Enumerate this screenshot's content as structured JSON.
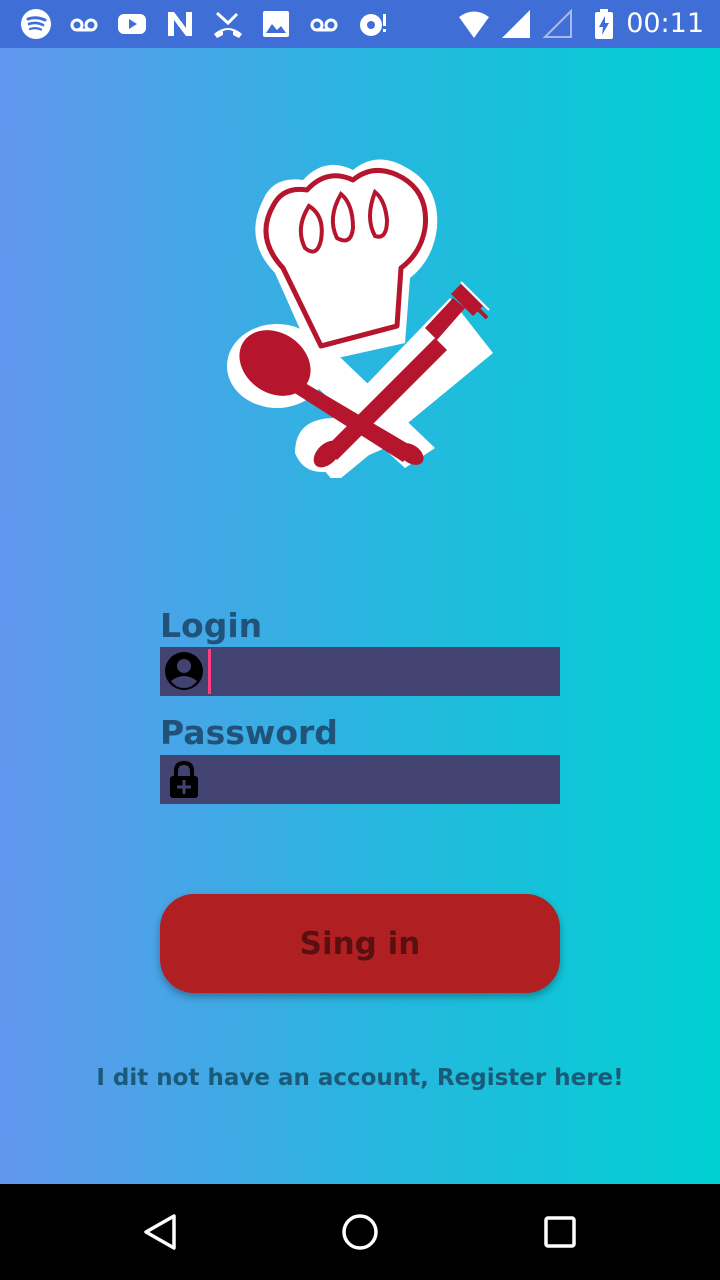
{
  "status_bar": {
    "time": "00:11",
    "icons": [
      "spotify-icon",
      "voicemail-icon",
      "youtube-icon",
      "n-app-icon",
      "missed-call-icon",
      "image-icon",
      "voicemail-icon",
      "sync-icon",
      "wifi-icon",
      "cell-signal-icon",
      "cell-signal-empty-icon",
      "battery-charging-icon"
    ]
  },
  "logo": {
    "icon": "chef-hat-spoon-fork-logo"
  },
  "form": {
    "login_label": "Login",
    "login_value": "",
    "login_icon": "account-circle-icon",
    "password_label": "Password",
    "password_value": "",
    "password_icon": "lock-plus-icon"
  },
  "signin_label": "Sing in",
  "register_text": "I dit not have an account, Register here!",
  "nav_bar": {
    "buttons": [
      "back-icon",
      "home-icon",
      "recents-icon"
    ]
  },
  "colors": {
    "status_bar": "#3f6fd6",
    "gradient_start": "#6396ee",
    "gradient_end": "#00d0d2",
    "input_bg": "#424370",
    "button_bg": "#b02022",
    "button_text": "#5a1010",
    "label_text": "#20527a",
    "cursor": "#ff3d7f"
  }
}
